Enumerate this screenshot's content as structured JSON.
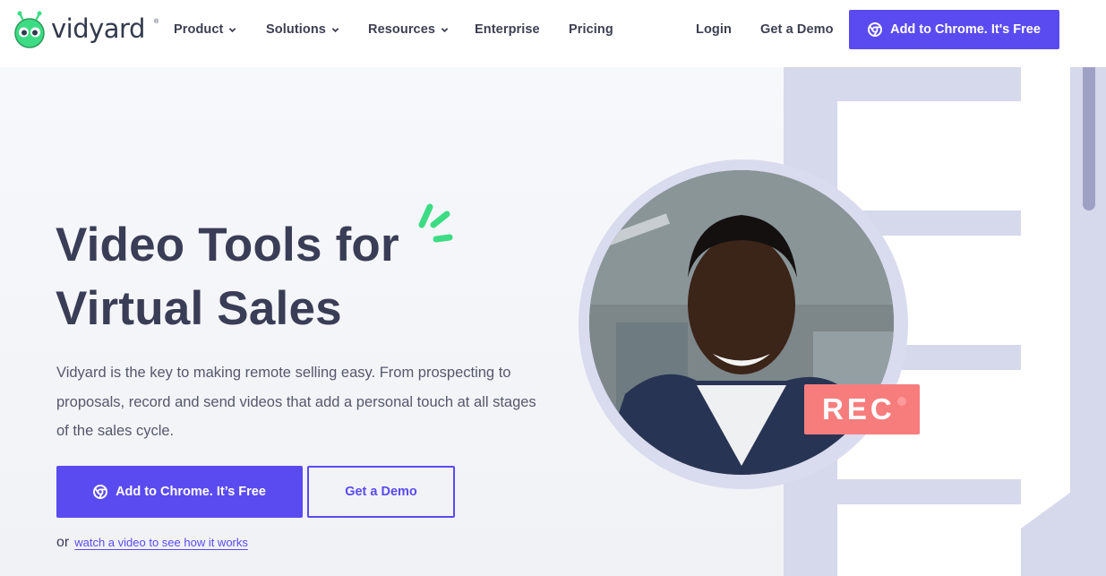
{
  "nav": {
    "brand": "vidyard",
    "brand_mark": "®",
    "items": [
      {
        "label": "Product",
        "dropdown": true
      },
      {
        "label": "Solutions",
        "dropdown": true
      },
      {
        "label": "Resources",
        "dropdown": true
      },
      {
        "label": "Enterprise",
        "dropdown": false
      },
      {
        "label": "Pricing",
        "dropdown": false
      }
    ],
    "login": "Login",
    "demo": "Get a Demo",
    "cta": "Add to Chrome. It's Free"
  },
  "hero": {
    "title_line1": "Video Tools for",
    "title_line2": "Virtual Sales",
    "description": "Vidyard is the key to making remote selling easy. From prospecting to proposals, record and send videos that add a personal touch at all stages of the sales cycle.",
    "primary_cta": "Add to Chrome. It’s Free",
    "secondary_cta": "Get a Demo",
    "or": "or",
    "video_link": "watch a video to see how it works",
    "rec_label": "REC"
  },
  "colors": {
    "brand": "#5a4bf0",
    "accent_green": "#3ddc84",
    "rec": "#f77d7d"
  },
  "icons": {
    "cta_icon": "chrome-icon",
    "dropdown_icon": "chevron-down-icon"
  }
}
